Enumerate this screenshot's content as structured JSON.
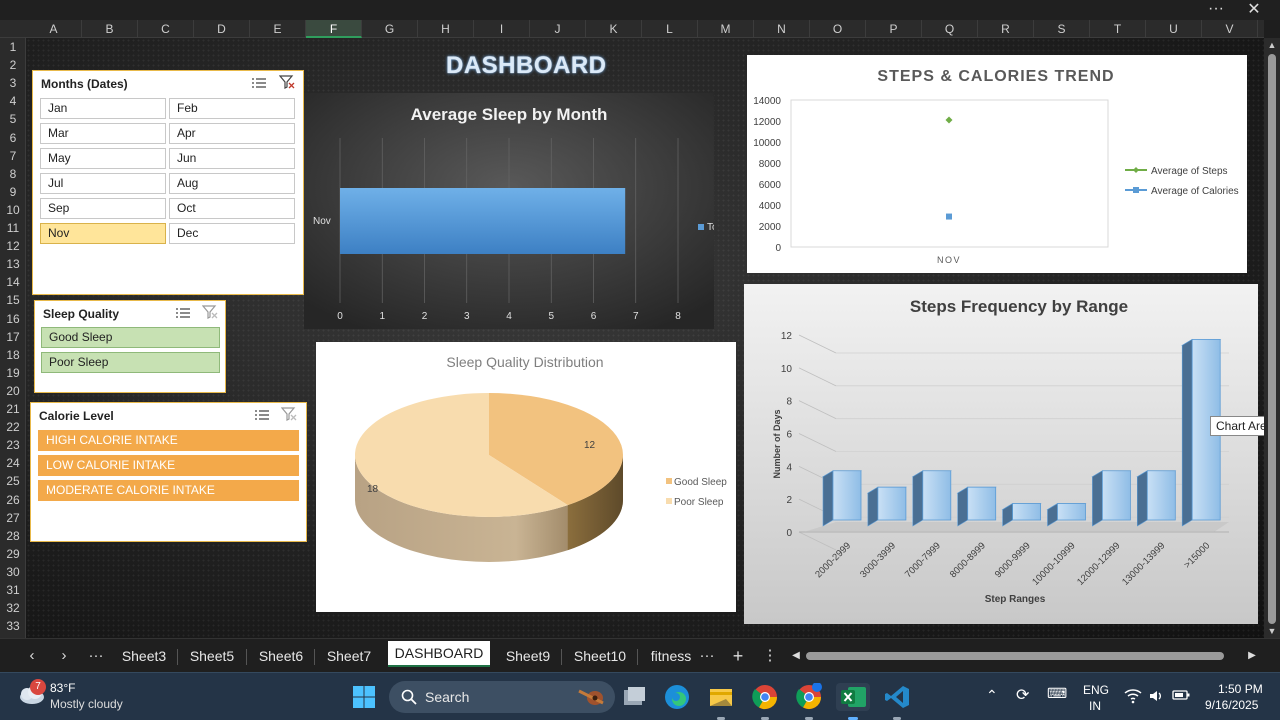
{
  "window": {
    "more_label": "···",
    "close_label": "✕"
  },
  "grid": {
    "columns": [
      "A",
      "B",
      "C",
      "D",
      "E",
      "F",
      "G",
      "H",
      "I",
      "J",
      "K",
      "L",
      "M",
      "N",
      "O",
      "P",
      "Q",
      "R",
      "S",
      "T",
      "U",
      "V"
    ],
    "selected_column": "F",
    "rows": [
      "1",
      "2",
      "3",
      "4",
      "5",
      "6",
      "7",
      "8",
      "9",
      "10",
      "11",
      "12",
      "13",
      "14",
      "15",
      "16",
      "17",
      "18",
      "19",
      "20",
      "21",
      "22",
      "23",
      "24",
      "25",
      "26",
      "27",
      "28",
      "29",
      "30",
      "31",
      "32",
      "33"
    ]
  },
  "dashboard_title": "DASHBOARD",
  "slicers": {
    "months": {
      "title": "Months (Dates)",
      "items": [
        "Jan",
        "Feb",
        "Mar",
        "Apr",
        "May",
        "Jun",
        "Jul",
        "Aug",
        "Sep",
        "Oct",
        "Nov",
        "Dec"
      ],
      "selected": "Nov"
    },
    "sleep_quality": {
      "title": "Sleep Quality",
      "items": [
        "Good Sleep",
        "Poor Sleep"
      ]
    },
    "calorie_level": {
      "title": "Calorie Level",
      "items": [
        "HIGH CALORIE INTAKE",
        "LOW CALORIE INTAKE",
        "MODERATE CALORIE INTAKE"
      ]
    }
  },
  "chart_data": [
    {
      "type": "bar",
      "title": "Average Sleep by Month",
      "orientation": "horizontal",
      "categories": [
        "Nov"
      ],
      "series": [
        {
          "name": "Total",
          "values": [
            6.75
          ]
        }
      ],
      "xlim": [
        0,
        8
      ],
      "xticks": [
        "0",
        "1",
        "2",
        "3",
        "4",
        "5",
        "6",
        "7",
        "8"
      ],
      "legend": "right",
      "grid": true,
      "colors": {
        "bar": "#5b9bd5",
        "background": "#3a3a3a"
      }
    },
    {
      "type": "scatter",
      "title": "STEPS & CALORIES TREND",
      "categories": [
        "NOV"
      ],
      "series": [
        {
          "name": "Average of Steps",
          "values": [
            12100
          ]
        },
        {
          "name": "Average of Calories",
          "values": [
            2900
          ]
        }
      ],
      "ylim": [
        0,
        14000
      ],
      "yticks": [
        "14000",
        "12000",
        "10000",
        "8000",
        "6000",
        "4000",
        "2000",
        "0"
      ],
      "legend": "right",
      "colors": {
        "steps": "#70ad47",
        "calories": "#5b9bd5"
      }
    },
    {
      "type": "pie",
      "title": "Sleep Quality Distribution",
      "categories": [
        "Good Sleep",
        "Poor Sleep"
      ],
      "values": [
        12,
        18
      ],
      "data_labels": [
        "12",
        "18"
      ],
      "legend": "right",
      "colors": {
        "good": "#f2c27f",
        "poor": "#f8dcae"
      }
    },
    {
      "type": "bar",
      "title": "Steps Frequency by Range",
      "categories": [
        "2000-2999",
        "3000-3999",
        "7000-7999",
        "8000-8999",
        "9000-9999",
        "10000-10999",
        "12000-12999",
        "13000-13999",
        ">15000"
      ],
      "values": [
        3,
        2,
        3,
        2,
        1,
        1,
        3,
        3,
        11
      ],
      "ylim": [
        0,
        12
      ],
      "yticks": [
        "12",
        "10",
        "8",
        "6",
        "4",
        "2",
        "0"
      ],
      "xlabel": "Step Ranges",
      "ylabel": "Number of Days",
      "grid": true,
      "colors": {
        "bar": "#9dc3e6"
      }
    }
  ],
  "tooltip": "Chart Area",
  "tabs": {
    "items": [
      "Sheet3",
      "Sheet5",
      "Sheet6",
      "Sheet7",
      "DASHBOARD",
      "Sheet9",
      "Sheet10",
      "fitness"
    ],
    "active": "DASHBOARD",
    "add_label": "+",
    "menu_label": "⋮",
    "more_label": "···"
  },
  "taskbar": {
    "weather_temp": "83°F",
    "weather_desc": "Mostly cloudy",
    "weather_badge": "7",
    "search_placeholder": "Search",
    "lang_line1": "ENG",
    "lang_line2": "IN",
    "time": "1:50 PM",
    "date": "9/16/2025"
  }
}
